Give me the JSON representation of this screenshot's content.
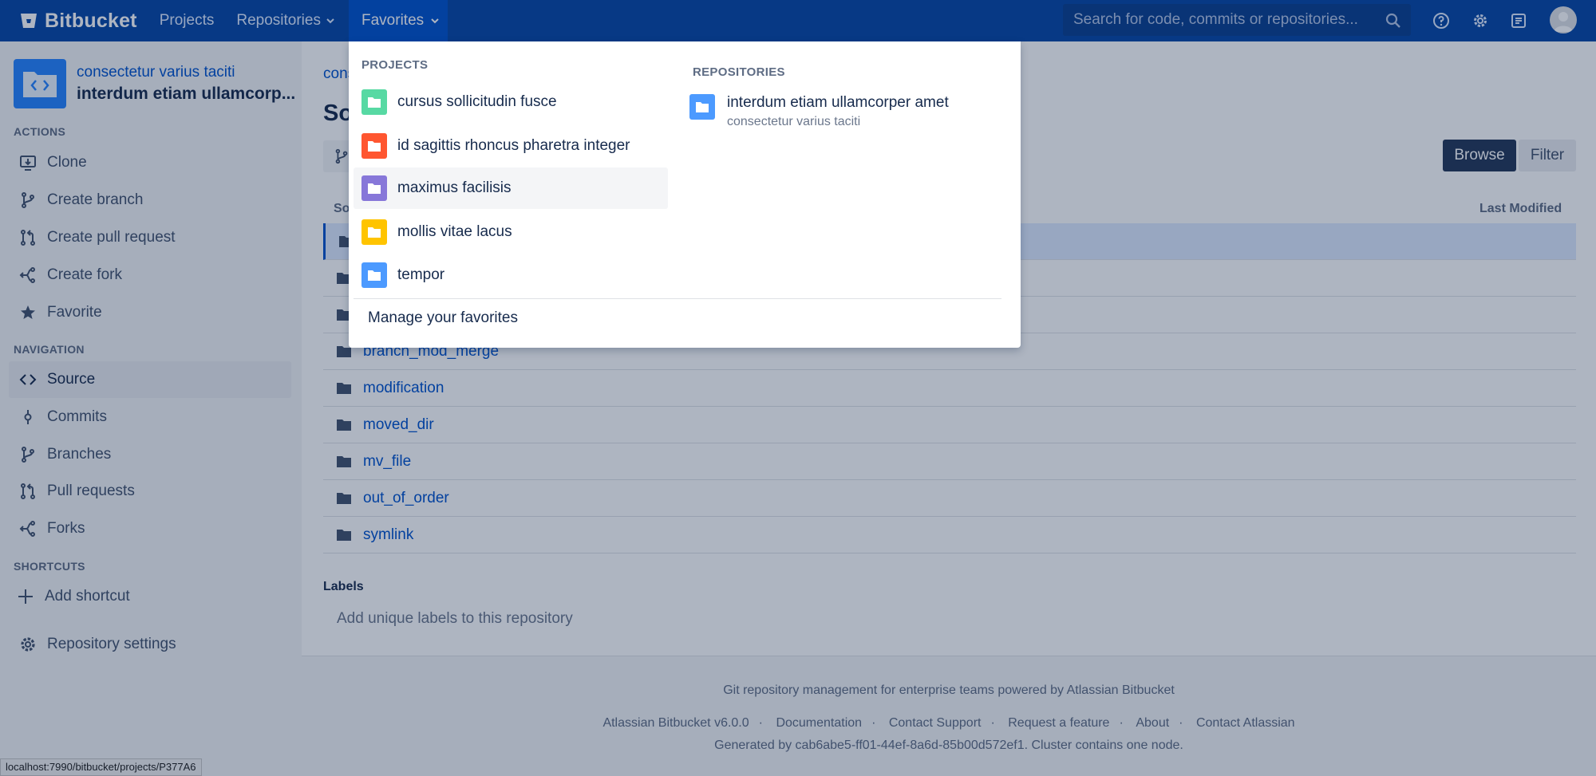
{
  "header": {
    "app_name": "Bitbucket",
    "nav_projects": "Projects",
    "nav_repositories": "Repositories",
    "nav_favorites": "Favorites",
    "search_placeholder": "Search for code, commits or repositories..."
  },
  "sidebar": {
    "project_name": "consectetur varius taciti",
    "repo_name": "interdum etiam ullamcorp...",
    "actions_heading": "ACTIONS",
    "actions": [
      {
        "label": "Clone",
        "icon": "clone-icon"
      },
      {
        "label": "Create branch",
        "icon": "branch-icon"
      },
      {
        "label": "Create pull request",
        "icon": "pull-request-icon"
      },
      {
        "label": "Create fork",
        "icon": "fork-icon"
      },
      {
        "label": "Favorite",
        "icon": "star-icon"
      }
    ],
    "navigation_heading": "NAVIGATION",
    "navigation": [
      {
        "label": "Source",
        "icon": "code-icon",
        "active": true
      },
      {
        "label": "Commits",
        "icon": "commit-icon"
      },
      {
        "label": "Branches",
        "icon": "branch-icon"
      },
      {
        "label": "Pull requests",
        "icon": "pull-request-icon"
      },
      {
        "label": "Forks",
        "icon": "fork-icon"
      }
    ],
    "shortcuts_heading": "SHORTCUTS",
    "add_shortcut": "Add shortcut",
    "repository_settings": "Repository settings",
    "status_url": "localhost:7990/bitbucket/projects/P377A6"
  },
  "main": {
    "breadcrumb": "cons",
    "title": "Sou",
    "browse_label": "Browse",
    "filter_label": "Filter",
    "col_source": "So",
    "col_last_modified": "Last Modified",
    "files": [
      "",
      "",
      "",
      "branch_mod_merge",
      "modification",
      "moved_dir",
      "mv_file",
      "out_of_order",
      "symlink"
    ],
    "labels_title": "Labels",
    "labels_add": "Add unique labels to this repository"
  },
  "footer": {
    "tagline": "Git repository management for enterprise teams powered by Atlassian Bitbucket",
    "links": [
      "Atlassian Bitbucket v6.0.0",
      "Documentation",
      "Contact Support",
      "Request a feature",
      "About",
      "Contact Atlassian"
    ],
    "generated": "Generated by cab6abe5-ff01-44ef-8a6d-85b00d572ef1. Cluster contains one node."
  },
  "favorites_dropdown": {
    "projects_heading": "PROJECTS",
    "projects": [
      {
        "name": "cursus sollicitudin fusce",
        "color": "#57d9a3"
      },
      {
        "name": "id sagittis rhoncus pharetra integer",
        "color": "#ff5630"
      },
      {
        "name": "maximus facilisis",
        "color": "#8777d9"
      },
      {
        "name": "mollis vitae lacus",
        "color": "#ffc400"
      },
      {
        "name": "tempor",
        "color": "#4c9aff"
      }
    ],
    "repositories_heading": "REPOSITORIES",
    "repositories": [
      {
        "name": "interdum etiam ullamcorper amet",
        "project": "consectetur varius taciti",
        "color": "#4c9aff"
      }
    ],
    "manage_label": "Manage your favorites"
  },
  "colors": {
    "header_bg": "#0747a6",
    "header_active": "#0052cc",
    "link": "#0052cc",
    "browse_bg": "#253858"
  }
}
